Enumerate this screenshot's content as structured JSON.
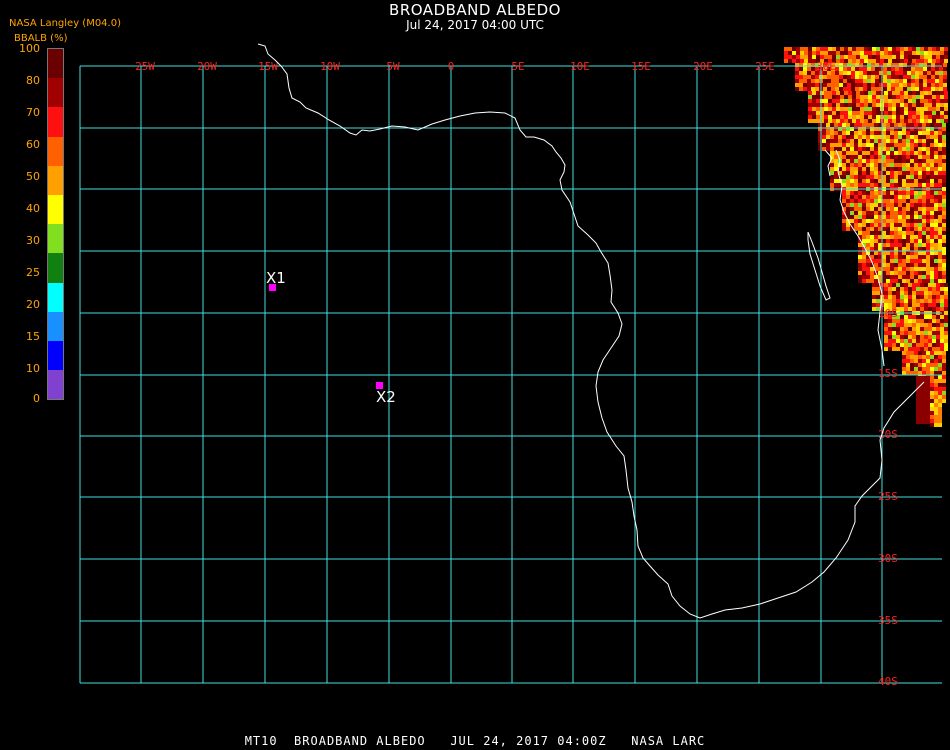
{
  "header": {
    "title": "BROADBAND ALBEDO",
    "subtitle": "Jul 24, 2017 04:00 UTC",
    "source": "NASA Langley (M04.0)",
    "unit": "BBALB (%)"
  },
  "legend": {
    "ticks": [
      "100",
      "80",
      "70",
      "60",
      "50",
      "40",
      "30",
      "25",
      "20",
      "15",
      "10",
      "0"
    ],
    "colors": [
      "#6a0000",
      "#a00000",
      "#ff1010",
      "#ff6000",
      "#ffa000",
      "#ffff00",
      "#80e020",
      "#108010",
      "#00ffff",
      "#1890ff",
      "#0000ff",
      "#8040d0"
    ]
  },
  "grid": {
    "lon_labels": [
      "25W",
      "20W",
      "15W",
      "10W",
      "5W",
      "0",
      "5E",
      "10E",
      "15E",
      "20E",
      "25E",
      "30E"
    ],
    "lat_labels": [
      "10S",
      "15S",
      "20S",
      "25S",
      "30S",
      "35S",
      "40S"
    ],
    "grid_color": "#40e0e0",
    "label_color": "#ff2020"
  },
  "markers": [
    {
      "label": "X1",
      "color": "#ff00ff"
    },
    {
      "label": "X2",
      "color": "#ff00ff"
    }
  ],
  "footer": "MT10  BROADBAND ALBEDO   JUL 24, 2017 04:00Z   NASA LARC"
}
